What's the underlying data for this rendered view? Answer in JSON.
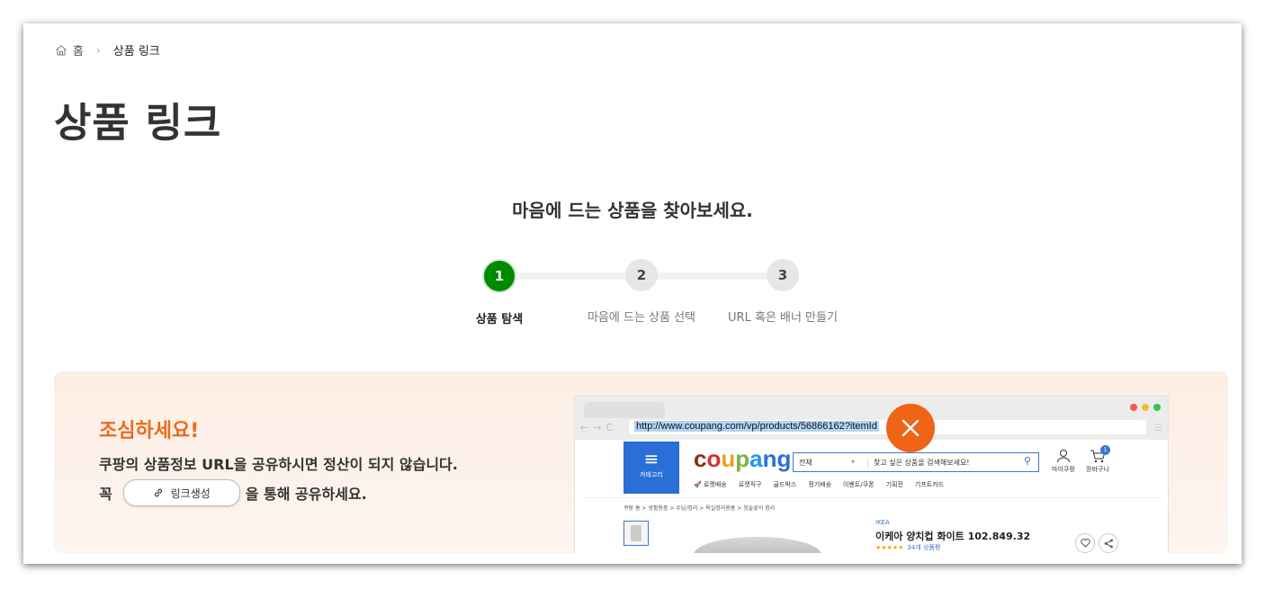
{
  "breadcrumb": {
    "home": "홈",
    "separator": "›",
    "current": "상품 링크"
  },
  "page_title": "상품 링크",
  "subtitle": "마음에 드는 상품을 찾아보세요.",
  "steps": [
    {
      "number": "1",
      "label": "상품 탐색",
      "active": true
    },
    {
      "number": "2",
      "label": "마음에 드는 상품 선택",
      "active": false
    },
    {
      "number": "3",
      "label": "URL 혹은 배너 만들기",
      "active": false
    }
  ],
  "warning": {
    "title": "조심하세요!",
    "line1": "쿠팡의 상품정보 URL을 공유하시면 정산이 되지 않습니다.",
    "line2_prefix": "꼭",
    "link_button": "링크생성",
    "line2_suffix": "을 통해 공유하세요."
  },
  "browser": {
    "url": "http://www.coupang.com/vp/products/56866162?itemId",
    "category_label": "카테고리",
    "search_scope": "전체",
    "search_placeholder": "찾고 싶은 상품을 검색해보세요!",
    "my_coupang": "마이쿠팡",
    "cart": "장바구니",
    "cart_count": "1",
    "subnav": [
      "로켓배송",
      "로켓직구",
      "골드박스",
      "정기배송",
      "이벤트/쿠폰",
      "기획전",
      "기프트카드"
    ],
    "crumbs": "쿠팡 홈 > 생활용품 > 수납/정리 > 욕실정리용품 > 칫솔꽂이 정리",
    "product_brand": "IKEA",
    "product_name": "이케아 양치컵 화이트 102.849.32",
    "rating_count": "34개 상품평",
    "stars": "★★★★★"
  },
  "colors": {
    "active_step": "#008a00",
    "warning_title": "#ee6a1d",
    "close_badge": "#f06416",
    "coupang_blue": "#2a6ed8"
  }
}
